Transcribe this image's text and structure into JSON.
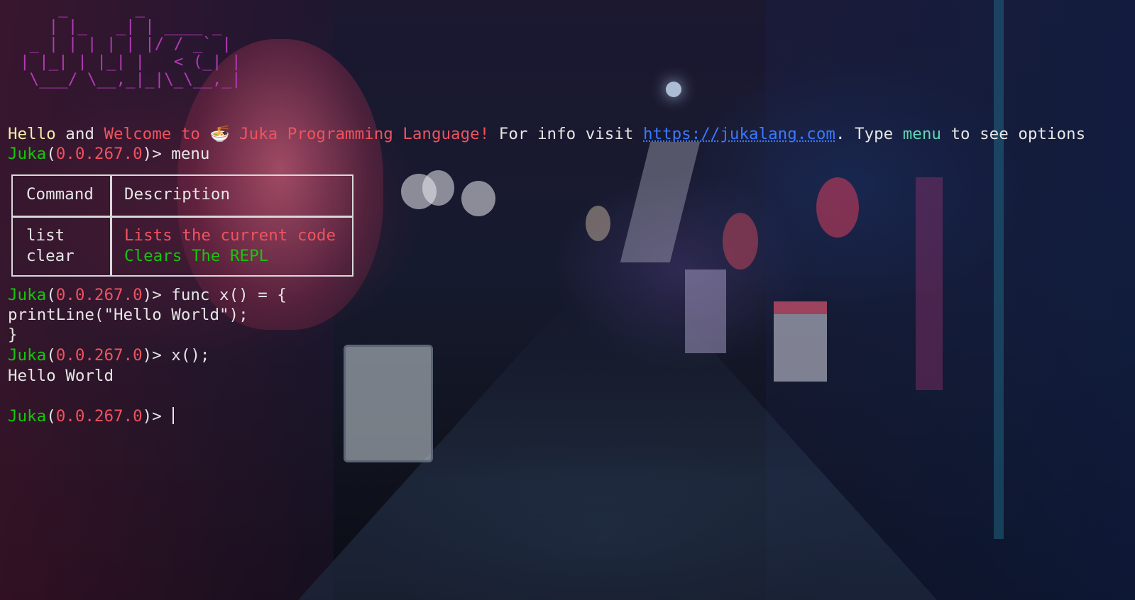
{
  "ascii_logo": "    _       _        \n   | |_   _| | ____ _ \n _ | | | | | |/ / _` |\n| |_| | |_| |   < (_| |\n \\___/ \\__,_|_|\\_\\__,_|",
  "welcome": {
    "hello": "Hello",
    "and": "and",
    "welcome_to": "Welcome to",
    "emoji": "🍜",
    "language": "Juka Programming Language!",
    "info_prefix": "For info visit",
    "url": "https://jukalang.com",
    "type_word": ". Type",
    "menu_word": "menu",
    "suffix": "to see options"
  },
  "prompt": {
    "name": "Juka",
    "version": "0.0.267.0",
    "open_paren": "(",
    "close": ")>"
  },
  "history": {
    "cmd1": "menu",
    "cmd2": "func x() = {",
    "line2b": "printLine(\"Hello World\");",
    "line2c": "}",
    "cmd3": "x();",
    "output3": "Hello World"
  },
  "menu_table": {
    "header_command": "Command",
    "header_description": "Description",
    "rows": [
      {
        "command": "list",
        "description": "Lists the current code"
      },
      {
        "command": "clear",
        "description": "Clears The REPL"
      }
    ]
  },
  "colors": {
    "prompt_green": "#16c60c",
    "version_red": "#f0525e",
    "hello_yellow": "#f3eea8",
    "link_blue": "#3b78ff",
    "menu_cyan": "#61d6b4",
    "logo_magenta": "#b53ab8"
  }
}
